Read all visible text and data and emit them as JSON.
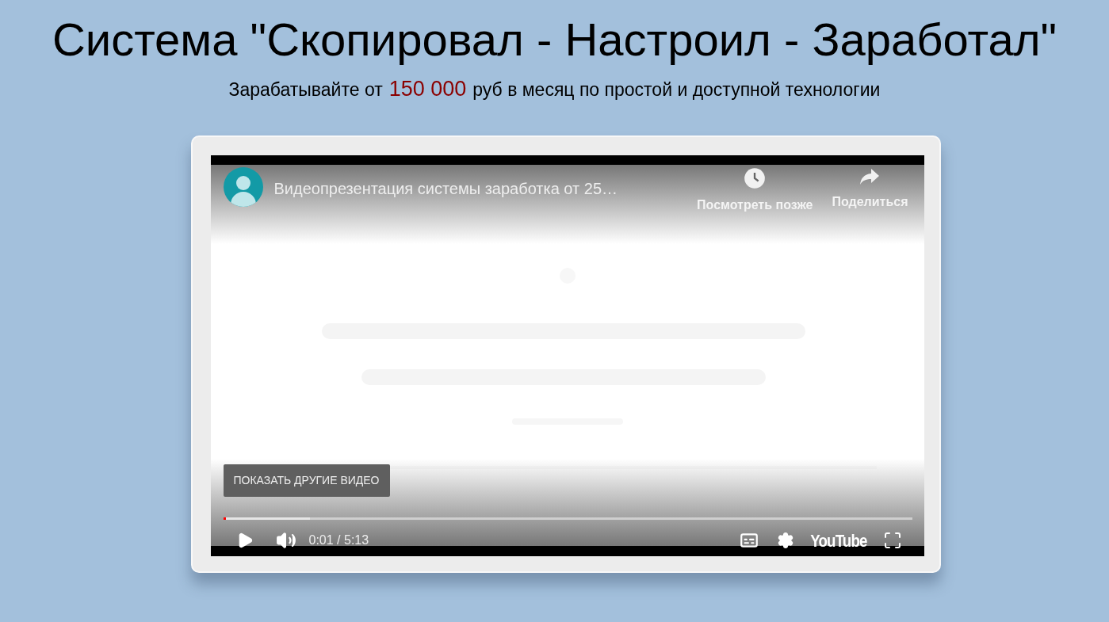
{
  "header": {
    "title": "Система \"Скопировал - Настроил - Заработал\"",
    "subtitle_before": "Зарабатывайте  от",
    "subtitle_amount": "150 000",
    "subtitle_after": "руб в месяц по простой и доступной технологии"
  },
  "video": {
    "title": "Видеопрезентация системы заработка от 25…",
    "actions": [
      {
        "kind": "watch-later",
        "label": "Посмотреть позже"
      },
      {
        "kind": "share",
        "label": "Поделиться"
      }
    ],
    "more_videos_button": "ПОКАЗАТЬ ДРУГИЕ ВИДЕО",
    "progress": {
      "level": 0.004
    },
    "buffered": {
      "level": 0.126
    },
    "time": "0:01 / 5:13",
    "logo": "YouTube"
  }
}
